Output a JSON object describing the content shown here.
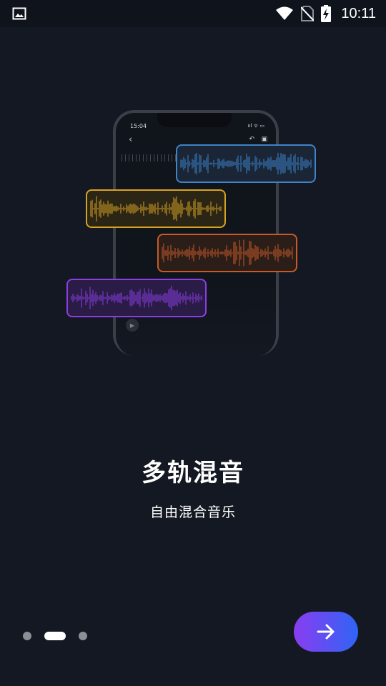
{
  "status_bar": {
    "time": "10:11",
    "icons": [
      "image-icon",
      "wifi-icon",
      "no-sim-icon",
      "battery-charging-icon"
    ]
  },
  "illustration": {
    "phone": {
      "time": "15:04",
      "status_icons": "ııl ᯤ ▭",
      "back_glyph": "‹",
      "undo_glyph": "↶",
      "save_glyph": "▣",
      "play_glyph": "▶"
    },
    "tracks": [
      {
        "name": "blue-track",
        "color": "#3f83c9"
      },
      {
        "name": "gold-track",
        "color": "#d9a322"
      },
      {
        "name": "orange-track",
        "color": "#c75a27"
      },
      {
        "name": "purple-track",
        "color": "#8a3fe0"
      }
    ]
  },
  "content": {
    "title": "多轨混音",
    "subtitle": "自由混合音乐"
  },
  "pagination": {
    "pages": 3,
    "active_index": 1
  },
  "next_button": {
    "icon": "arrow-right-icon"
  }
}
